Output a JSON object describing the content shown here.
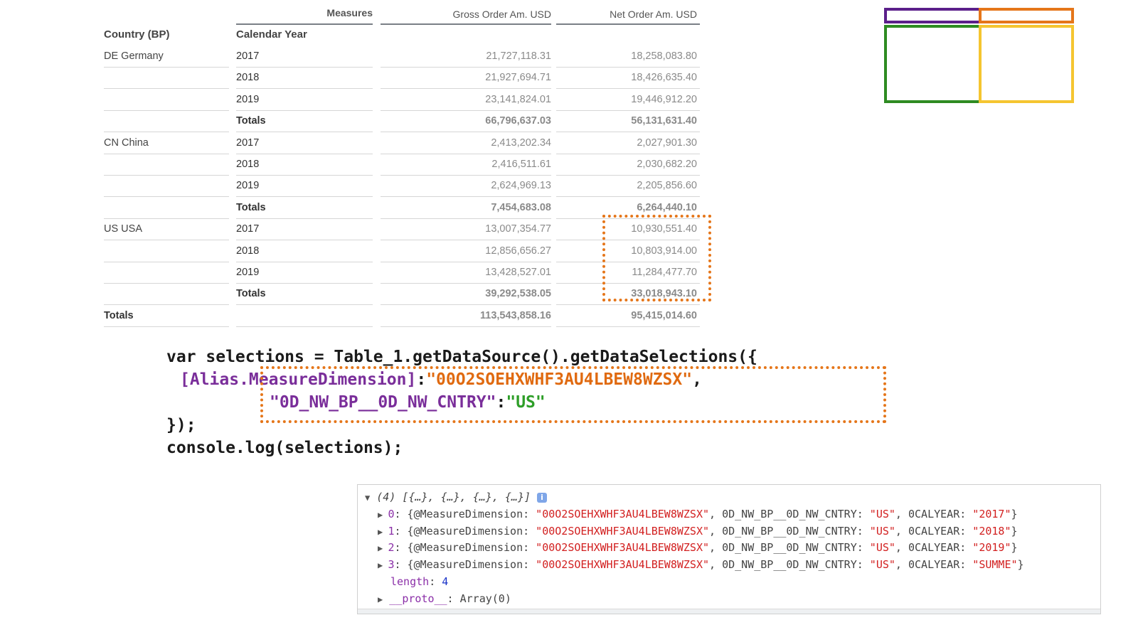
{
  "table": {
    "measures_label": "Measures",
    "gross_header": "Gross Order Am. USD",
    "net_header": "Net Order Am. USD",
    "country_header": "Country (BP)",
    "year_header": "Calendar Year",
    "rows": [
      {
        "country": "DE Germany",
        "year": "2017",
        "gross": "21,727,118.31",
        "net": "18,258,083.80",
        "total": false
      },
      {
        "country": "",
        "year": "2018",
        "gross": "21,927,694.71",
        "net": "18,426,635.40",
        "total": false
      },
      {
        "country": "",
        "year": "2019",
        "gross": "23,141,824.01",
        "net": "19,446,912.20",
        "total": false
      },
      {
        "country": "",
        "year": "Totals",
        "gross": "66,796,637.03",
        "net": "56,131,631.40",
        "total": true
      },
      {
        "country": "CN China",
        "year": "2017",
        "gross": "2,413,202.34",
        "net": "2,027,901.30",
        "total": false
      },
      {
        "country": "",
        "year": "2018",
        "gross": "2,416,511.61",
        "net": "2,030,682.20",
        "total": false
      },
      {
        "country": "",
        "year": "2019",
        "gross": "2,624,969.13",
        "net": "2,205,856.60",
        "total": false
      },
      {
        "country": "",
        "year": "Totals",
        "gross": "7,454,683.08",
        "net": "6,264,440.10",
        "total": true
      },
      {
        "country": "US USA",
        "year": "2017",
        "gross": "13,007,354.77",
        "net": "10,930,551.40",
        "total": false
      },
      {
        "country": "",
        "year": "2018",
        "gross": "12,856,656.27",
        "net": "10,803,914.00",
        "total": false
      },
      {
        "country": "",
        "year": "2019",
        "gross": "13,428,527.01",
        "net": "11,284,477.70",
        "total": false
      },
      {
        "country": "",
        "year": "Totals",
        "gross": "39,292,538.05",
        "net": "33,018,943.10",
        "total": true
      },
      {
        "country": "Totals",
        "year": "",
        "gross": "113,543,858.16",
        "net": "95,415,014.60",
        "total": true
      }
    ]
  },
  "legend_colors": {
    "purple": "#5b1f8a",
    "orange": "#e5761a",
    "green": "#2e8b22",
    "yellow": "#f5c530"
  },
  "code": {
    "line1": "var selections = Table_1.getDataSource().getDataSelections({",
    "line2_key": "[Alias.MeasureDimension]",
    "line2_colon": ":",
    "line2_value": "\"00O2SOEHXWHF3AU4LBEW8WZSX\"",
    "line2_comma": ",",
    "line3_key": "\"0D_NW_BP__0D_NW_CNTRY\"",
    "line3_colon": ":",
    "line3_value": "\"US\"",
    "line4": "});",
    "line5": "console.log(selections);"
  },
  "console": {
    "header": "(4) [{…}, {…}, {…}, {…}]",
    "info_icon": "i",
    "entries": [
      {
        "index": "0",
        "measure_key": "@MeasureDimension",
        "measure_value": "\"00O2SOEHXWHF3AU4LBEW8WZSX\"",
        "country_key": "0D_NW_BP__0D_NW_CNTRY",
        "country_value": "\"US\"",
        "year_key": "0CALYEAR",
        "year_value": "\"2017\""
      },
      {
        "index": "1",
        "measure_key": "@MeasureDimension",
        "measure_value": "\"00O2SOEHXWHF3AU4LBEW8WZSX\"",
        "country_key": "0D_NW_BP__0D_NW_CNTRY",
        "country_value": "\"US\"",
        "year_key": "0CALYEAR",
        "year_value": "\"2018\""
      },
      {
        "index": "2",
        "measure_key": "@MeasureDimension",
        "measure_value": "\"00O2SOEHXWHF3AU4LBEW8WZSX\"",
        "country_key": "0D_NW_BP__0D_NW_CNTRY",
        "country_value": "\"US\"",
        "year_key": "0CALYEAR",
        "year_value": "\"2019\""
      },
      {
        "index": "3",
        "measure_key": "@MeasureDimension",
        "measure_value": "\"00O2SOEHXWHF3AU4LBEW8WZSX\"",
        "country_key": "0D_NW_BP__0D_NW_CNTRY",
        "country_value": "\"US\"",
        "year_key": "0CALYEAR",
        "year_value": "\"SUMME\""
      }
    ],
    "length_key": "length",
    "length_value": "4",
    "proto_key": "__proto__",
    "proto_value": "Array(0)"
  }
}
